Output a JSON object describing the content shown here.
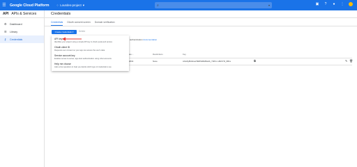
{
  "topbar": {
    "brand": "Google Cloud Platform",
    "project": "Lourdes-project",
    "icons": [
      "gift-icon",
      "help-icon",
      "bell-icon",
      "more-icon",
      "avatar"
    ]
  },
  "sidenav": {
    "header": "APIs & Services",
    "api_badge": "API",
    "items": [
      {
        "label": "Dashboard",
        "icon": "dashboard-icon"
      },
      {
        "label": "Library",
        "icon": "library-icon"
      },
      {
        "label": "Credentials",
        "icon": "key-icon",
        "active": true
      }
    ]
  },
  "page": {
    "title": "Credentials",
    "tabs": [
      "Credentials",
      "OAuth consent screen",
      "Domain verification"
    ]
  },
  "toolbar": {
    "create_label": "Create credentials",
    "delete_label": "Delete"
  },
  "dropdown": {
    "items": [
      {
        "title": "API key",
        "desc": "Identifies your project using a simple API key to check quota and access"
      },
      {
        "title": "OAuth client ID",
        "desc": "Requests user consent so your app can access the user's data"
      },
      {
        "title": "Service account key",
        "desc": "Enables server-to-server, app-level authentication using robot accounts"
      },
      {
        "title": "Help me choose",
        "desc": "Asks a few questions to help you decide which type of credential to use"
      }
    ]
  },
  "doc_text": {
    "pre": "authentication",
    "link": "documentation"
  },
  "table": {
    "headers": {
      "date": "ate",
      "restrictions": "Restrictions",
      "key": "Key"
    },
    "row": {
      "date": "2019",
      "restrictions": "None",
      "key": "AIzaSyBUdsvw7ERI9cRHBaGb_Y9rKrv-x6R1YD_6R1s"
    }
  },
  "colors": {
    "accent": "#1a73e8",
    "annotation_arrow": "#e53935"
  }
}
